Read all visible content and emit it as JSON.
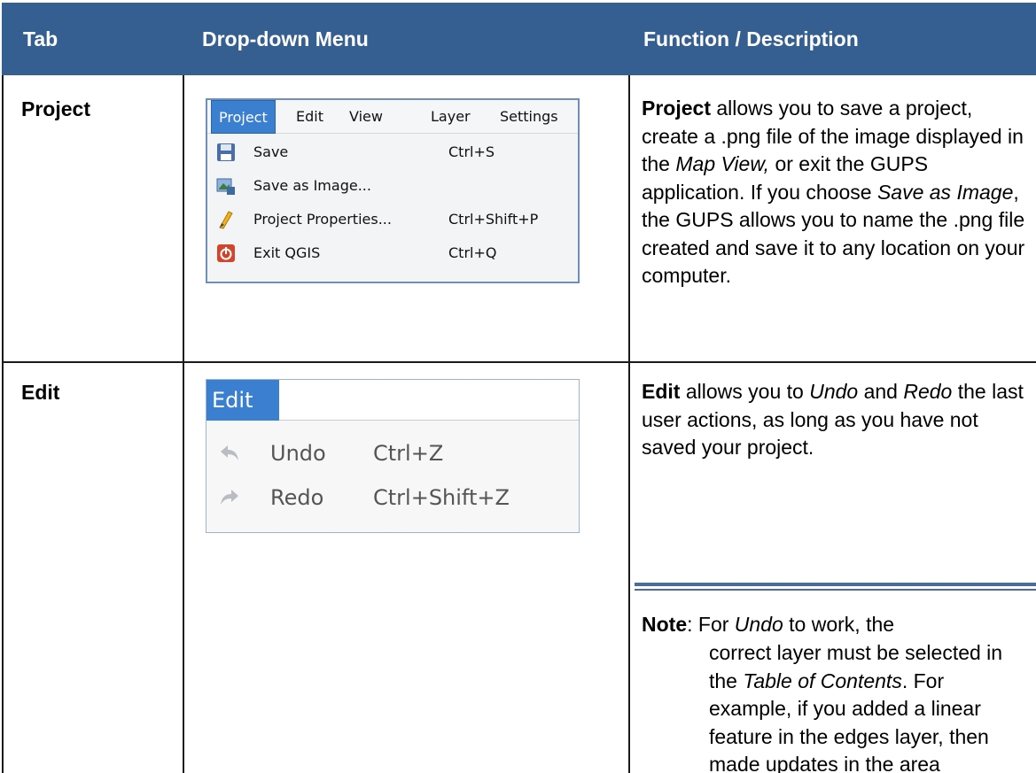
{
  "header": {
    "tab": "Tab",
    "dropdown": "Drop-down Menu",
    "function": "Function / Description"
  },
  "rows": [
    {
      "tab": "Project",
      "menu": {
        "menubar": [
          "Project",
          "Edit",
          "View",
          "Layer",
          "Settings"
        ],
        "items": [
          {
            "icon": "save-icon",
            "label": "Save",
            "shortcut": "Ctrl+S"
          },
          {
            "icon": "save-image-icon",
            "label": "Save as Image...",
            "shortcut": ""
          },
          {
            "icon": "project-properties-icon",
            "label": "Project Properties...",
            "shortcut": "Ctrl+Shift+P"
          },
          {
            "icon": "exit-icon",
            "label": "Exit QGIS",
            "shortcut": "Ctrl+Q"
          }
        ]
      },
      "description": {
        "bold": "Project",
        "part1": " allows you to save a project, create a .png file of the image displayed in the ",
        "italic1": "Map View,",
        "part2": " or exit the GUPS application. If you choose ",
        "italic2": "Save as Image",
        "part3": ", the GUPS allows you to name the .png file created and save it to any location on your computer."
      }
    },
    {
      "tab": "Edit",
      "menu": {
        "menubar": [
          "Edit"
        ],
        "items": [
          {
            "icon": "undo-icon",
            "label": "Undo",
            "shortcut": "Ctrl+Z"
          },
          {
            "icon": "redo-icon",
            "label": "Redo",
            "shortcut": "Ctrl+Shift+Z"
          }
        ]
      },
      "description": {
        "bold": "Edit",
        "part1": " allows you to ",
        "italic1": "Undo",
        "part2": " and ",
        "italic2": "Redo",
        "part3": " the last user actions, as long as you have not saved your project."
      },
      "note": {
        "label": "Note",
        "lead": ": For ",
        "italic1": "Undo",
        "lead2": " to work, the",
        "body1": "correct layer must be selected in the ",
        "italic2": "Table of Contents",
        "body2": ". For example, if you added a linear feature in the edges layer, then made updates in the area"
      }
    }
  ],
  "colors": {
    "header_bg": "#365f91",
    "menu_highlight": "#3b7fd1"
  }
}
